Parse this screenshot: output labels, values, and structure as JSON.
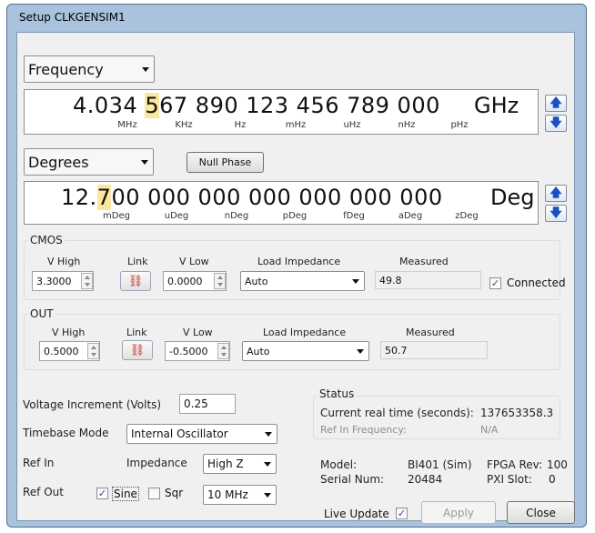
{
  "window": {
    "title": "Setup CLKGENSIM1"
  },
  "frequency": {
    "mode": "Frequency",
    "value_part1": "4.034 ",
    "value_highlight": "5",
    "value_part2": "67 890 123 456 789 000",
    "unit": "GHz",
    "sub_units": [
      "MHz",
      "KHz",
      "Hz",
      "mHz",
      "uHz",
      "nHz",
      "pHz"
    ]
  },
  "phase": {
    "mode": "Degrees",
    "null_phase_label": "Null Phase",
    "value_part1": "12.",
    "value_highlight": "7",
    "value_part2": "00 000 000 000 000 000 000",
    "unit": "Deg",
    "sub_units": [
      "mDeg",
      "uDeg",
      "nDeg",
      "pDeg",
      "fDeg",
      "aDeg",
      "zDeg"
    ]
  },
  "cmos": {
    "title": "CMOS",
    "vhigh_label": "V High",
    "link_label": "Link",
    "vlow_label": "V Low",
    "load_label": "Load Impedance",
    "measured_label": "Measured",
    "vhigh": "3.3000",
    "vlow": "0.0000",
    "load": "Auto",
    "measured": "49.8",
    "connected_label": "Connected",
    "connected_checked": true
  },
  "out": {
    "title": "OUT",
    "vhigh_label": "V High",
    "link_label": "Link",
    "vlow_label": "V Low",
    "load_label": "Load Impedance",
    "measured_label": "Measured",
    "vhigh": "0.5000",
    "vlow": "-0.5000",
    "load": "Auto",
    "measured": "50.7"
  },
  "settings": {
    "voltage_increment_label": "Voltage Increment (Volts)",
    "voltage_increment": "0.25",
    "timebase_label": "Timebase Mode",
    "timebase": "Internal Oscillator",
    "refin_label": "Ref In",
    "impedance_label": "Impedance",
    "impedance": "High Z",
    "refout_label": "Ref Out",
    "sine_label": "Sine",
    "sine_checked": true,
    "sqr_label": "Sqr",
    "sqr_checked": false,
    "refout_freq": "10 MHz"
  },
  "status": {
    "title": "Status",
    "realtime_label": "Current real time (seconds):",
    "realtime": "137653358.3",
    "refin_freq_label": "Ref In Frequency:",
    "refin_freq": "N/A",
    "model_label": "Model:",
    "model": "BI401 (Sim)",
    "fpga_label": "FPGA Rev:",
    "fpga": "100",
    "serial_label": "Serial Num:",
    "serial": "20484",
    "pxi_label": "PXI Slot:",
    "pxi": "0"
  },
  "footer": {
    "live_update_label": "Live Update",
    "live_update_checked": true,
    "apply_label": "Apply",
    "close_label": "Close"
  },
  "colors": {
    "digit_highlight": "#fbe7a1",
    "spin_arrow": "#1b4fc4",
    "frame": "#a9c2dd"
  }
}
